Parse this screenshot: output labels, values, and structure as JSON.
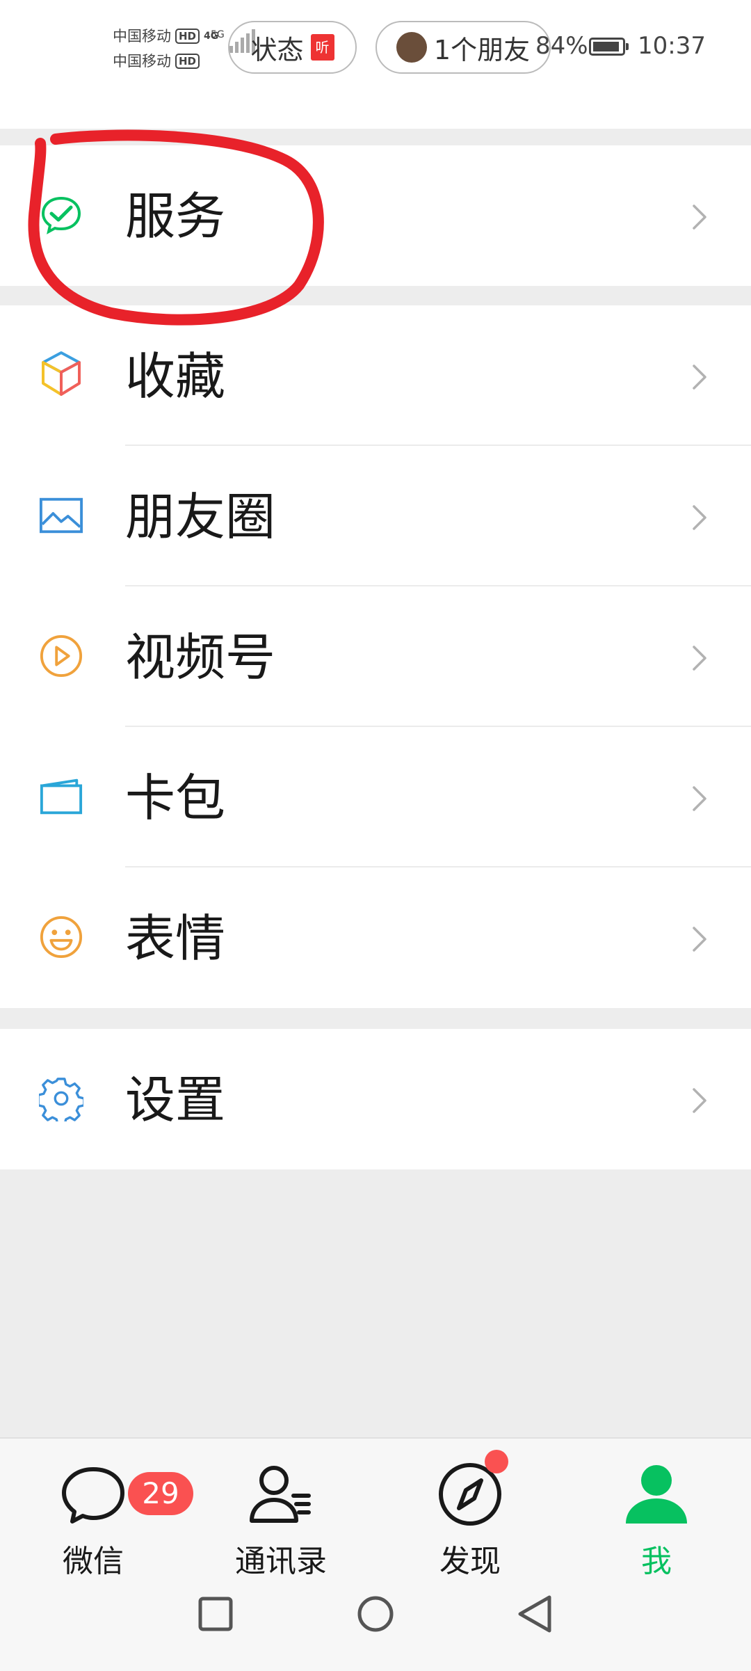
{
  "status_bar": {
    "carrier_1": "中国移动",
    "carrier_2": "中国移动",
    "hd_label": "HD",
    "net_1": "4G",
    "net_2": "5G",
    "pill_1_text": "状态",
    "pill_1_badge": "听",
    "pill_2_text": "1个朋友",
    "battery_percent": "84%",
    "time": "10:37"
  },
  "menu": {
    "service": {
      "label": "服务",
      "icon": "wechat-pay-check-icon"
    },
    "items": [
      {
        "label": "收藏",
        "icon": "cube-icon"
      },
      {
        "label": "朋友圈",
        "icon": "image-landscape-icon"
      },
      {
        "label": "视频号",
        "icon": "play-circle-icon"
      },
      {
        "label": "卡包",
        "icon": "card-wallet-icon"
      },
      {
        "label": "表情",
        "icon": "smiley-icon"
      }
    ],
    "settings": {
      "label": "设置",
      "icon": "gear-icon"
    }
  },
  "tabbar": {
    "tabs": [
      {
        "label": "微信",
        "icon": "chat-bubble-icon",
        "badge": "29"
      },
      {
        "label": "通讯录",
        "icon": "contacts-icon"
      },
      {
        "label": "发现",
        "icon": "compass-icon",
        "has_dot": true
      },
      {
        "label": "我",
        "icon": "person-icon",
        "active": true
      }
    ]
  },
  "colors": {
    "accent": "#07c160",
    "badge_red": "#fa5151",
    "annotation_red": "#e8222a",
    "background": "#ededed"
  }
}
